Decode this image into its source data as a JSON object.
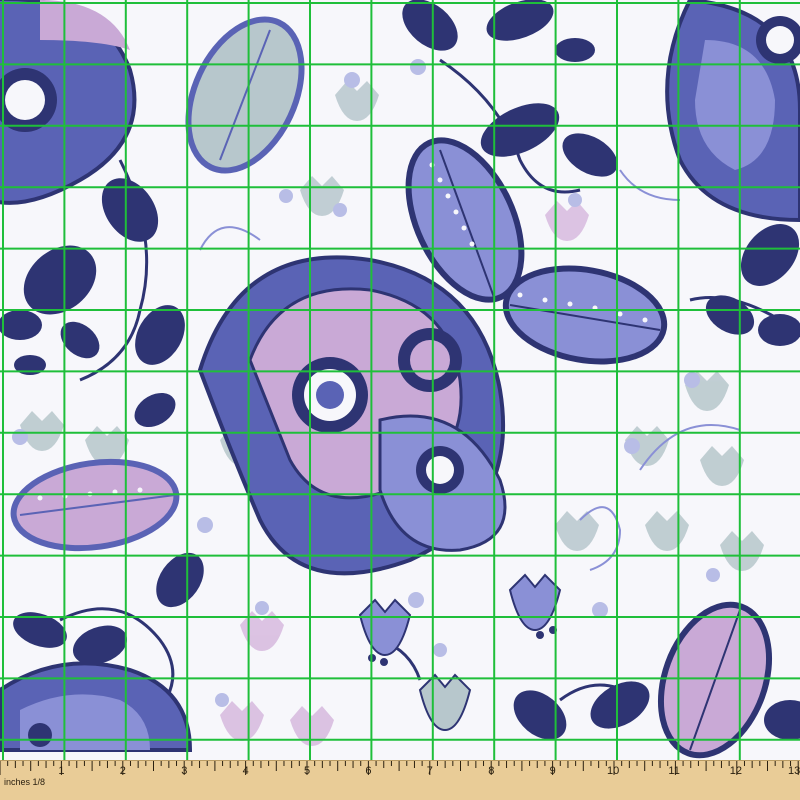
{
  "image": {
    "subject": "printed paisley fabric swatch with measurement grid",
    "palette": {
      "background": "#f7f7fb",
      "navy": "#2e3473",
      "indigo": "#5a63b5",
      "periwinkle": "#8a90d6",
      "lavender": "#c9a9d6",
      "sage": "#b7c7cc",
      "grid": "#1fbf3a",
      "ruler": "#e9cc97"
    }
  },
  "ruler": {
    "unit_label": "inches 1/8",
    "numbers": [
      "1",
      "2",
      "3",
      "4",
      "5",
      "6",
      "7",
      "8",
      "9",
      "10",
      "11",
      "12",
      "13"
    ]
  }
}
